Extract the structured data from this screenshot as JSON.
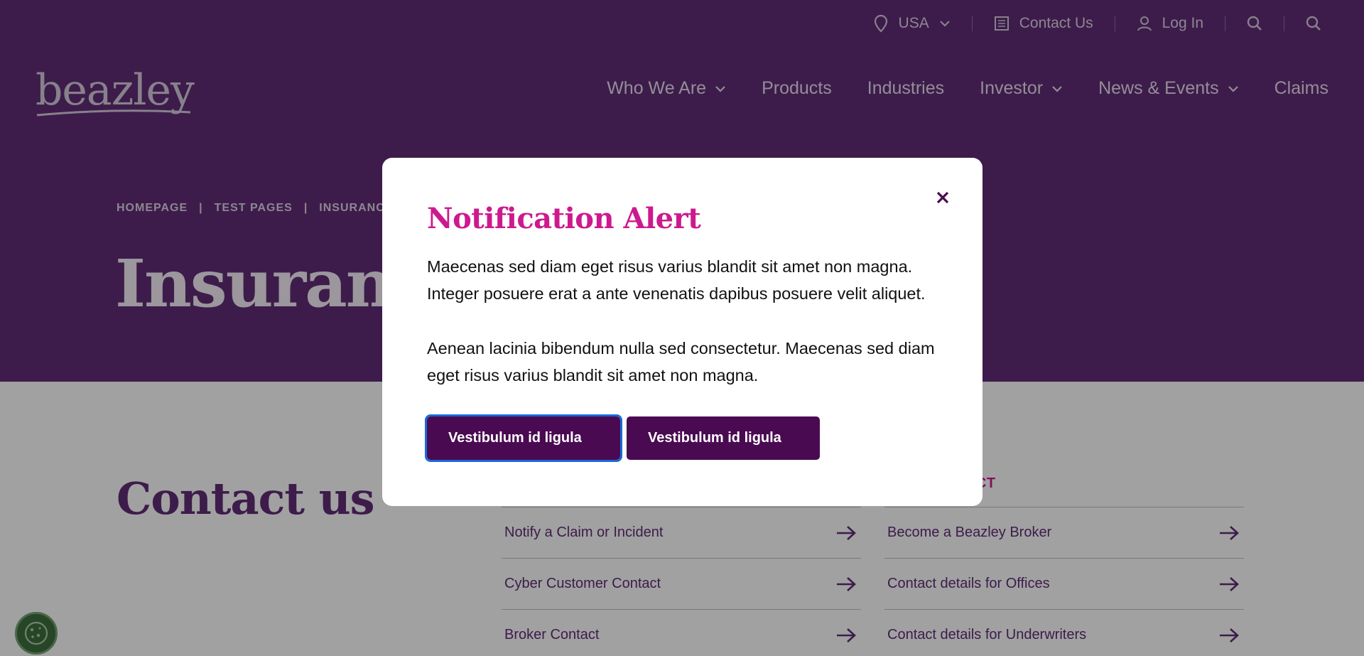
{
  "utility_nav": {
    "country": "USA",
    "contact": "Contact Us",
    "login": "Log In"
  },
  "logo": {
    "text": "beazley"
  },
  "main_nav": [
    {
      "label": "Who We Are",
      "dropdown": true
    },
    {
      "label": "Products",
      "dropdown": false
    },
    {
      "label": "Industries",
      "dropdown": false
    },
    {
      "label": "Investor",
      "dropdown": true
    },
    {
      "label": "News & Events",
      "dropdown": true
    },
    {
      "label": "Claims",
      "dropdown": false
    }
  ],
  "breadcrumb": [
    "HOMEPAGE",
    "TEST PAGES",
    "INSURANCE PR"
  ],
  "hero_title": "Insurance",
  "contact": {
    "title": "Contact us",
    "right_heading": "ACT",
    "left_links": [
      "Notify a Claim or Incident",
      "Cyber Customer Contact",
      "Broker Contact"
    ],
    "right_links": [
      "Become a Beazley Broker",
      "Contact details for Offices",
      "Contact details for Underwriters"
    ]
  },
  "modal": {
    "title": "Notification Alert",
    "paragraph1": "Maecenas sed diam eget risus varius blandit sit amet non magna. Integer posuere erat a ante venenatis dapibus posuere velit aliquet.",
    "paragraph2": "Aenean lacinia bibendum nulla sed consectetur. Maecenas sed diam eget risus varius blandit sit amet non magna.",
    "button1": "Vestibulum id ligula",
    "button2": "Vestibulum id ligula"
  },
  "colors": {
    "brand_purple": "#5e2b73",
    "accent_magenta": "#cc1a8e",
    "button_purple": "#4a0a52"
  }
}
